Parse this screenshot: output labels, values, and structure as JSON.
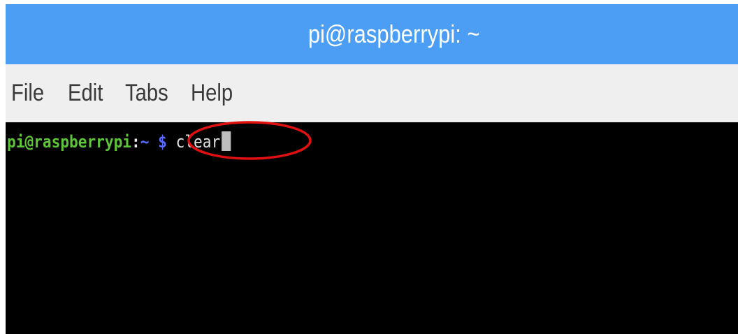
{
  "window": {
    "title": "pi@raspberrypi: ~"
  },
  "menubar": {
    "items": [
      {
        "label": "File"
      },
      {
        "label": "Edit"
      },
      {
        "label": "Tabs"
      },
      {
        "label": "Help"
      }
    ]
  },
  "terminal": {
    "user_host": "pi@raspberrypi",
    "colon": ":",
    "path": "~",
    "dollar": "$",
    "command": "clear"
  },
  "annotation": {
    "color": "#e01010",
    "shape": "ellipse",
    "target": "$ clear"
  },
  "colors": {
    "titlebar": "#4b9ef3",
    "menubar": "#efefef",
    "terminal_bg": "#000000",
    "prompt_user": "#5ec43a",
    "prompt_path": "#5a6bff"
  }
}
